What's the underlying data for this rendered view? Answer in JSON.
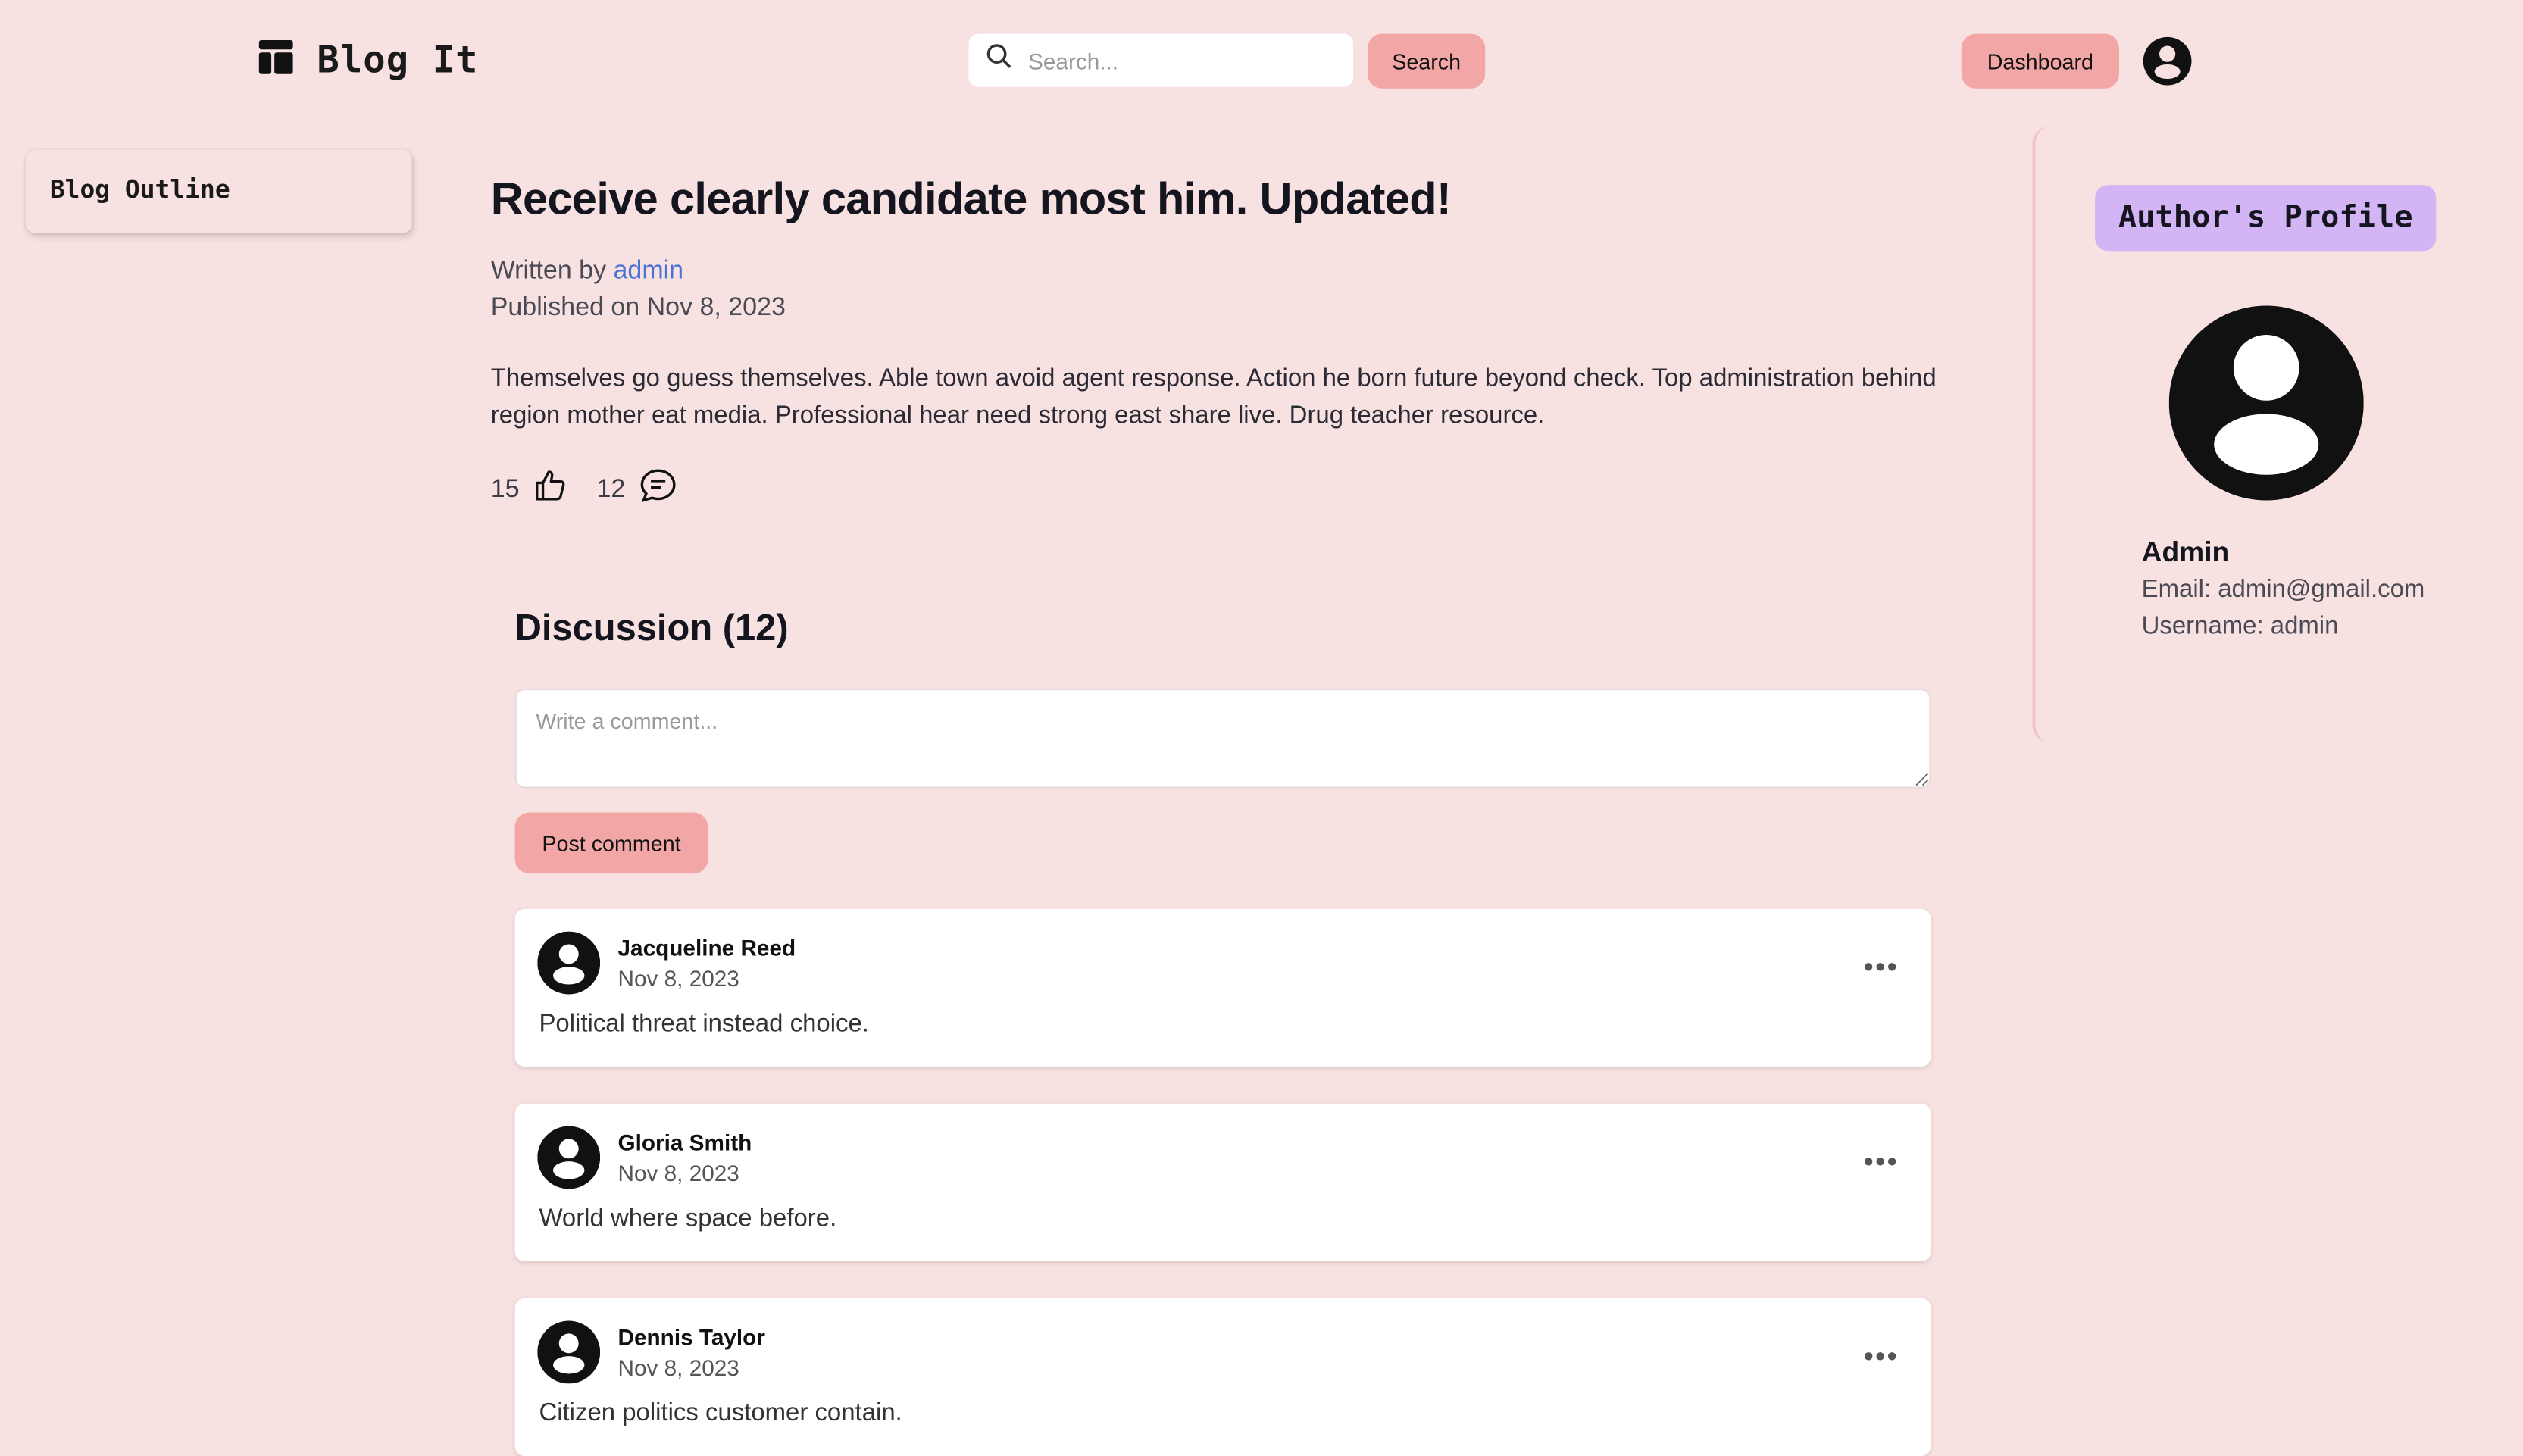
{
  "header": {
    "logo_text": "Blog It",
    "search_placeholder": "Search...",
    "search_button": "Search",
    "dashboard_button": "Dashboard"
  },
  "sidebar": {
    "outline_title": "Blog Outline"
  },
  "article": {
    "title": "Receive clearly candidate most him. Updated!",
    "written_by_label": "Written by",
    "author_link": "admin",
    "published": "Published on Nov 8, 2023",
    "body": "Themselves go guess themselves. Able town avoid agent response. Action he born future beyond check. Top administration behind region mother eat media. Professional hear need strong east share live. Drug teacher resource.",
    "likes": "15",
    "comments_count": "12"
  },
  "discussion": {
    "title": "Discussion (12)",
    "comment_placeholder": "Write a comment...",
    "post_button": "Post comment",
    "comments": [
      {
        "name": "Jacqueline Reed",
        "date": "Nov 8, 2023",
        "text": "Political threat instead choice."
      },
      {
        "name": "Gloria Smith",
        "date": "Nov 8, 2023",
        "text": "World where space before."
      },
      {
        "name": "Dennis Taylor",
        "date": "Nov 8, 2023",
        "text": "Citizen politics customer contain."
      }
    ]
  },
  "profile": {
    "badge": "Author's Profile",
    "name": "Admin",
    "email": "Email: admin@gmail.com",
    "username": "Username: admin"
  },
  "colors": {
    "background": "#f8e1e1",
    "button": "#f2a6a6",
    "badge": "#d3b4f4",
    "link": "#4a73d6"
  },
  "icons": [
    "dashboard-icon",
    "search-icon",
    "user-circle-icon",
    "thumbs-up-icon",
    "chat-bubble-icon",
    "more-horizontal-icon"
  ]
}
